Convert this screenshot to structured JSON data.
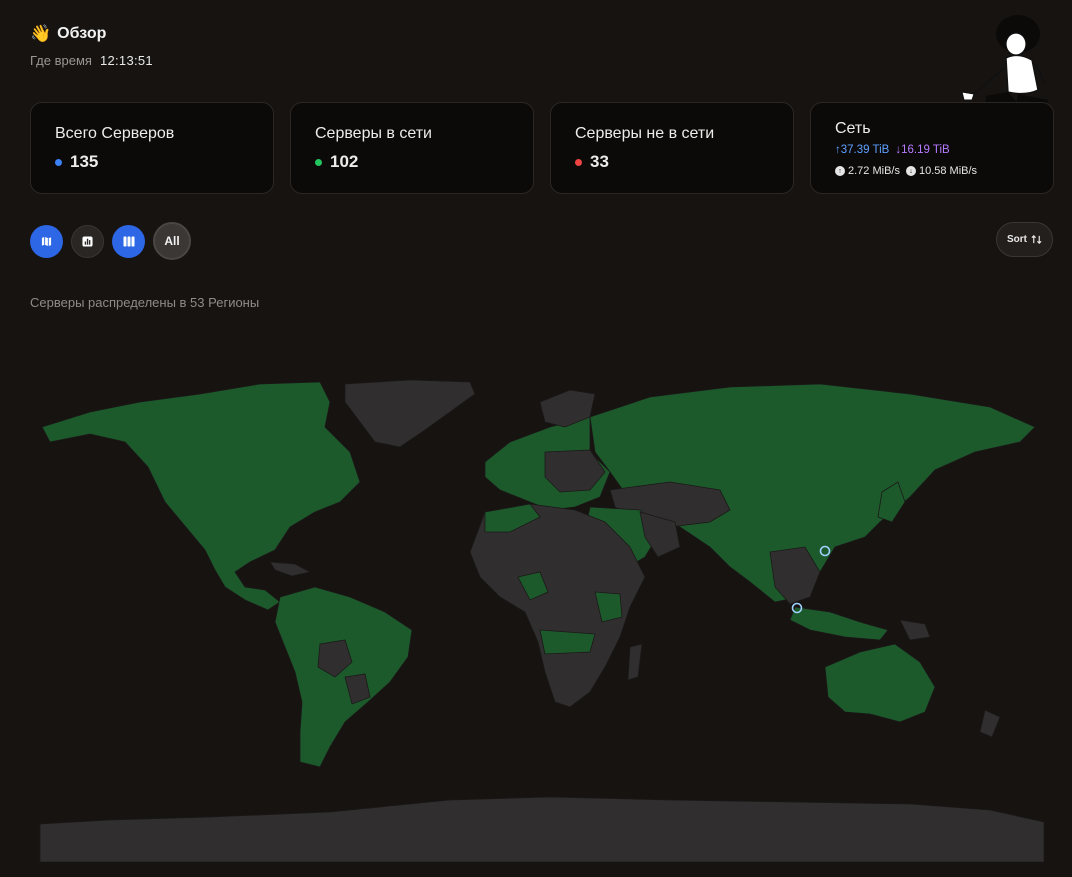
{
  "header": {
    "emoji": "👋",
    "title": "Обзор",
    "time_label": "Где время",
    "time_value": "12:13:51"
  },
  "cards": {
    "total": {
      "title": "Всего Серверов",
      "value": "135",
      "dot_color": "#3b82f6"
    },
    "online": {
      "title": "Серверы в сети",
      "value": "102",
      "dot_color": "#22c55e"
    },
    "offline": {
      "title": "Серверы не в сети",
      "value": "33",
      "dot_color": "#ef4444"
    },
    "network": {
      "title": "Сеть",
      "upload_total": "↑37.39 TiB",
      "download_total": "↓16.19 TiB",
      "upload_speed": "2.72 MiB/s",
      "download_speed": "10.58 MiB/s"
    }
  },
  "toolbar": {
    "buttons": [
      {
        "icon": "map-icon",
        "active": true
      },
      {
        "icon": "chart-icon",
        "active": false
      },
      {
        "icon": "columns-icon",
        "active": true
      }
    ],
    "all_label": "All",
    "sort_label": "Sort"
  },
  "regions_text": "Серверы распределены в 53 Регионы",
  "colors": {
    "active_region": "#1c5a2c",
    "inactive_region": "#302e2e",
    "accent_blue": "#2d67e6"
  }
}
